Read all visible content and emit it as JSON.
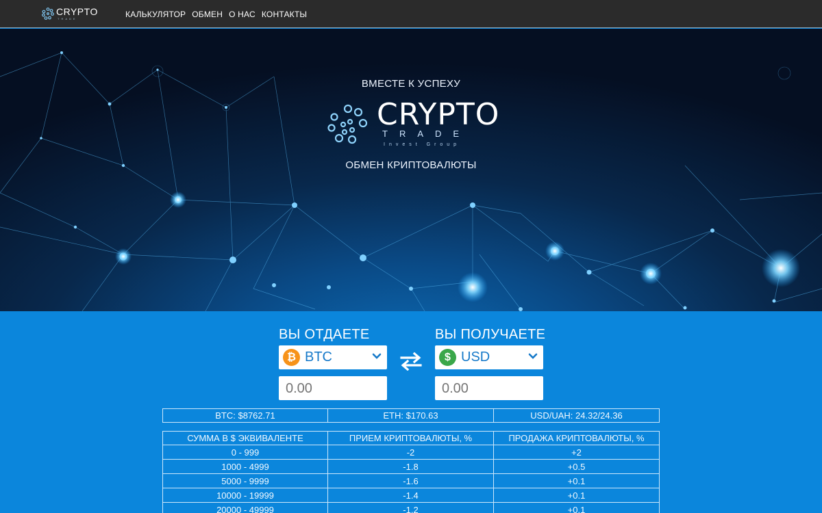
{
  "nav": {
    "logo_word": "CRYPTO",
    "logo_sub": "TRADE",
    "links": [
      "КАЛЬКУЛЯТОР",
      "ОБМЕН",
      "О НАС",
      "КОНТАКТЫ"
    ]
  },
  "hero": {
    "tagline": "ВМЕСТЕ К УСПЕХУ",
    "logo_word": "CRYPTO",
    "logo_trade": "TRADE",
    "logo_invest": "Invest Group",
    "subtitle": "ОБМЕН КРИПТОВАЛЮТЫ"
  },
  "calculator": {
    "give_label": "ВЫ ОТДАЕТЕ",
    "get_label": "ВЫ ПОЛУЧАЕТЕ",
    "give_currency": "BTC",
    "get_currency": "USD",
    "give_icon": "bitcoin-icon",
    "get_icon": "dollar-icon",
    "give_amount_placeholder": "0.00",
    "get_amount_placeholder": "0.00",
    "swap_icon": "swap-arrows-icon"
  },
  "rates": [
    "BTC: $8762.71",
    "ETH: $170.63",
    "USD/UAH: 24.32/24.36"
  ],
  "fees": {
    "headers": [
      "СУММА В $ ЭКВИВАЛЕНТЕ",
      "ПРИЕМ КРИПТОВАЛЮТЫ, %",
      "ПРОДАЖА КРИПТОВАЛЮТЫ, %"
    ],
    "rows": [
      [
        "0 - 999",
        "-2",
        "+2"
      ],
      [
        "1000 - 4999",
        "-1.8",
        "+0.5"
      ],
      [
        "5000 - 9999",
        "-1.6",
        "+0.1"
      ],
      [
        "10000 - 19999",
        "-1.4",
        "+0.1"
      ],
      [
        "20000 - 49999",
        "-1.2",
        "+0.1"
      ]
    ]
  },
  "colors": {
    "navbar": "#2b2b2b",
    "page_blue": "#0b86dc",
    "bitcoin_orange": "#f7931a",
    "dollar_green": "#3aa74a",
    "accent_text": "#1679c9"
  }
}
